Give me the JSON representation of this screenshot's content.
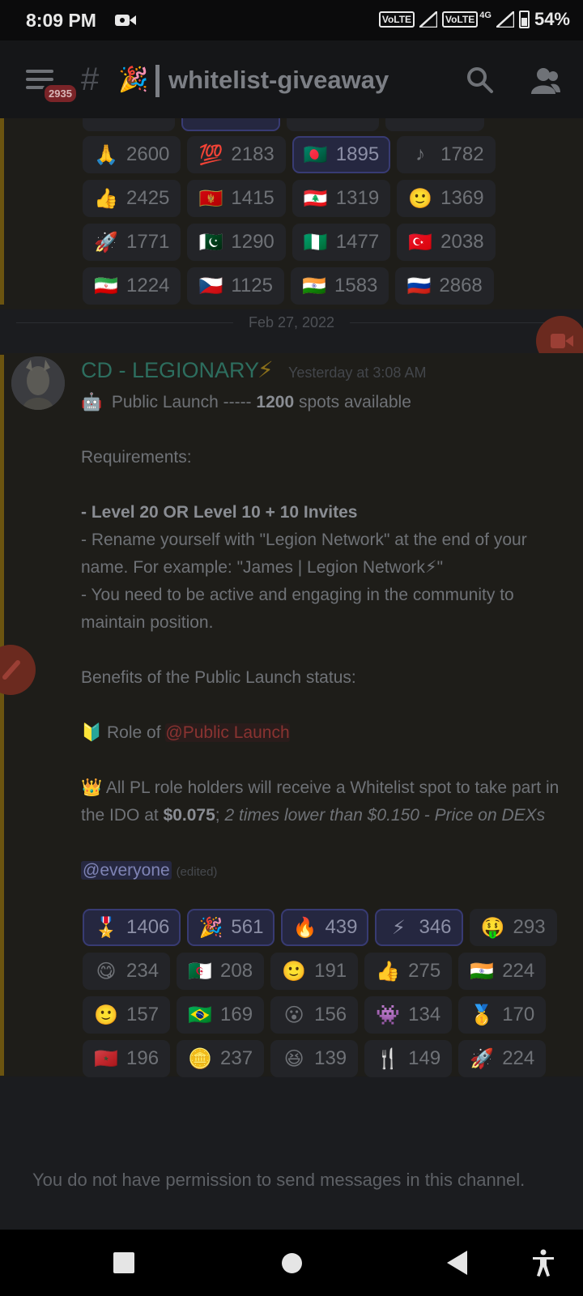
{
  "status_bar": {
    "time": "8:09 PM",
    "volte1": "VoLTE",
    "volte2": "VoLTE",
    "network": "4G",
    "battery": "54%"
  },
  "header": {
    "unread_badge": "2935",
    "hash": "#",
    "channel_emoji": "🎉",
    "channel_name": "whitelist-giveaway"
  },
  "previous_reactions": [
    {
      "emoji": "🙏",
      "count": "2600",
      "me": false
    },
    {
      "emoji": "💯",
      "count": "2183",
      "me": false
    },
    {
      "emoji": "🇧🇩",
      "count": "1895",
      "me": true
    },
    {
      "emoji": "♪",
      "count": "1782",
      "me": false
    },
    {
      "emoji": "👍",
      "count": "2425",
      "me": false
    },
    {
      "emoji": "🇲🇪",
      "count": "1415",
      "me": false
    },
    {
      "emoji": "🇱🇧",
      "count": "1319",
      "me": false
    },
    {
      "emoji": "🙂",
      "count": "1369",
      "me": false
    },
    {
      "emoji": "🚀",
      "count": "1771",
      "me": false
    },
    {
      "emoji": "🇵🇰",
      "count": "1290",
      "me": false
    },
    {
      "emoji": "🇳🇬",
      "count": "1477",
      "me": false
    },
    {
      "emoji": "🇹🇷",
      "count": "2038",
      "me": false
    },
    {
      "emoji": "🇮🇷",
      "count": "1224",
      "me": false
    },
    {
      "emoji": "🇨🇿",
      "count": "1125",
      "me": false
    },
    {
      "emoji": "🇮🇳",
      "count": "1583",
      "me": false
    },
    {
      "emoji": "🇷🇺",
      "count": "2868",
      "me": false
    }
  ],
  "date_divider": "Feb 27, 2022",
  "message": {
    "author": "CD - LEGIONARY",
    "author_emoji": "⚡",
    "timestamp": "Yesterday at 3:08 AM",
    "line1_emoji": "🤖",
    "line1_text": "Public Launch  -----",
    "line1_bold": "1200",
    "line1_tail": "spots available",
    "requirements_title": "Requirements:",
    "req1": "- Level 20 OR Level 10 + 10 Invites",
    "req2": "- Rename yourself with \"Legion Network\" at the end of your name. For example: \"James | Legion Network⚡\"",
    "req3": "- You need to be active and engaging in the community to maintain position.",
    "benefits_title": "Benefits of the Public Launch status:",
    "role_emoji": "🔰",
    "role_prefix": "Role of",
    "role_mention": "@Public Launch",
    "crown_emoji": "👑",
    "whitelist_text": "All PL role holders will receive a Whitelist spot to take part in the IDO at",
    "price_bold": "$0.075",
    "price_sep": ";",
    "price_italic": "2 times lower than $0.150 - Price on DEXs",
    "everyone": "@everyone",
    "edited": "(edited)"
  },
  "message_reactions": [
    {
      "emoji": "🎖️",
      "count": "1406",
      "me": true
    },
    {
      "emoji": "🎉",
      "count": "561",
      "me": true
    },
    {
      "emoji": "🔥",
      "count": "439",
      "me": true
    },
    {
      "emoji": "⚡",
      "count": "346",
      "me": true
    },
    {
      "emoji": "🤑",
      "count": "293",
      "me": false
    },
    {
      "emoji": "😋",
      "count": "234",
      "me": false
    },
    {
      "emoji": "🇩🇿",
      "count": "208",
      "me": false
    },
    {
      "emoji": "🙂",
      "count": "191",
      "me": false
    },
    {
      "emoji": "👍",
      "count": "275",
      "me": false
    },
    {
      "emoji": "🇮🇳",
      "count": "224",
      "me": false
    },
    {
      "emoji": "🙂",
      "count": "157",
      "me": false
    },
    {
      "emoji": "🇧🇷",
      "count": "169",
      "me": false
    },
    {
      "emoji": "😮",
      "count": "156",
      "me": false
    },
    {
      "emoji": "👾",
      "count": "134",
      "me": false
    },
    {
      "emoji": "🥇",
      "count": "170",
      "me": false
    },
    {
      "emoji": "🇲🇦",
      "count": "196",
      "me": false
    },
    {
      "emoji": "🪙",
      "count": "237",
      "me": false
    },
    {
      "emoji": "😆",
      "count": "139",
      "me": false
    },
    {
      "emoji": "🍴",
      "count": "149",
      "me": false
    },
    {
      "emoji": "🚀",
      "count": "224",
      "me": false
    }
  ],
  "no_permission_text": "You do not have permission to send messages in this channel."
}
